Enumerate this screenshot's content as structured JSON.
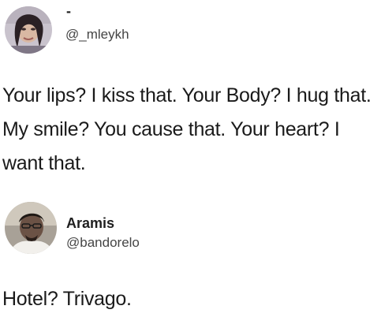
{
  "tweets": [
    {
      "display_name": "-",
      "handle": "@_mleykh",
      "text": "Your lips? I kiss that. Your Body? I hug that. My smile? You cause that. Your heart? I want that.",
      "avatar_icon": "avatar-photo"
    },
    {
      "display_name": "Aramis",
      "handle": "@bandorelo",
      "text": "Hotel? Trivago.",
      "avatar_icon": "avatar-photo"
    }
  ]
}
